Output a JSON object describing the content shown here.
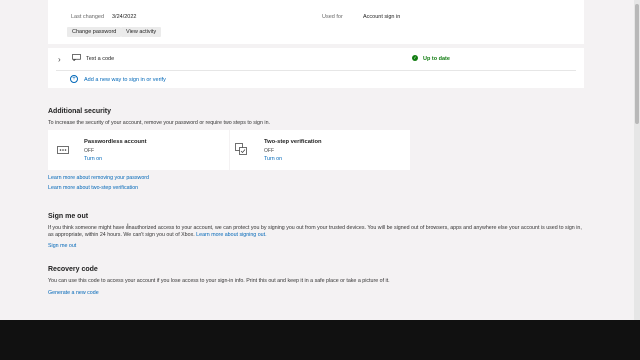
{
  "top_card": {
    "last_changed_label": "Last changed",
    "last_changed_value": "3/24/2022",
    "used_for_label": "Used for",
    "used_for_value": "Account sign in",
    "change_password_label": "Change password",
    "view_activity_label": "View activity"
  },
  "methods": {
    "text_code_label": "Text a code",
    "status_label": "Up to date",
    "add_method_label": "Add a new way to sign in or verify"
  },
  "additional_security": {
    "title": "Additional security",
    "description": "To increase the security of your account, remove your password or require two steps to sign in.",
    "passwordless": {
      "title": "Passwordless account",
      "state": "OFF",
      "action": "Turn on"
    },
    "two_step": {
      "title": "Two-step verification",
      "state": "OFF",
      "action": "Turn on"
    },
    "learn_removing": "Learn more about removing your password",
    "learn_two_step": "Learn more about two-step verification"
  },
  "sign_me_out": {
    "title": "Sign me out",
    "text_line1": "If you think someone might have unauthorized access to your account, we can protect you by signing you out from your trusted devices. You will be signed out of browsers, apps and anywhere else your account is used to sign in, as appropriate,",
    "text_line2": "within 24 hours. We can't sign you out of Xbox.",
    "inline_link": "Learn more about signing out.",
    "action": "Sign me out"
  },
  "recovery_code": {
    "title": "Recovery code",
    "text": "You can use this code to access your account if you lose access to your sign-in info. Print this out and keep it in a safe place or take a picture of it.",
    "action": "Generate a new code"
  },
  "icons": {
    "expand": "chevron-right-icon",
    "message": "message-icon",
    "status": "checkmark-circle-icon",
    "add": "add-circle-icon",
    "passwordless": "password-dots-icon",
    "two_step": "two-step-icon"
  },
  "colors": {
    "link": "#0067b8",
    "success": "#107c10",
    "background": "#f4f2f3"
  }
}
